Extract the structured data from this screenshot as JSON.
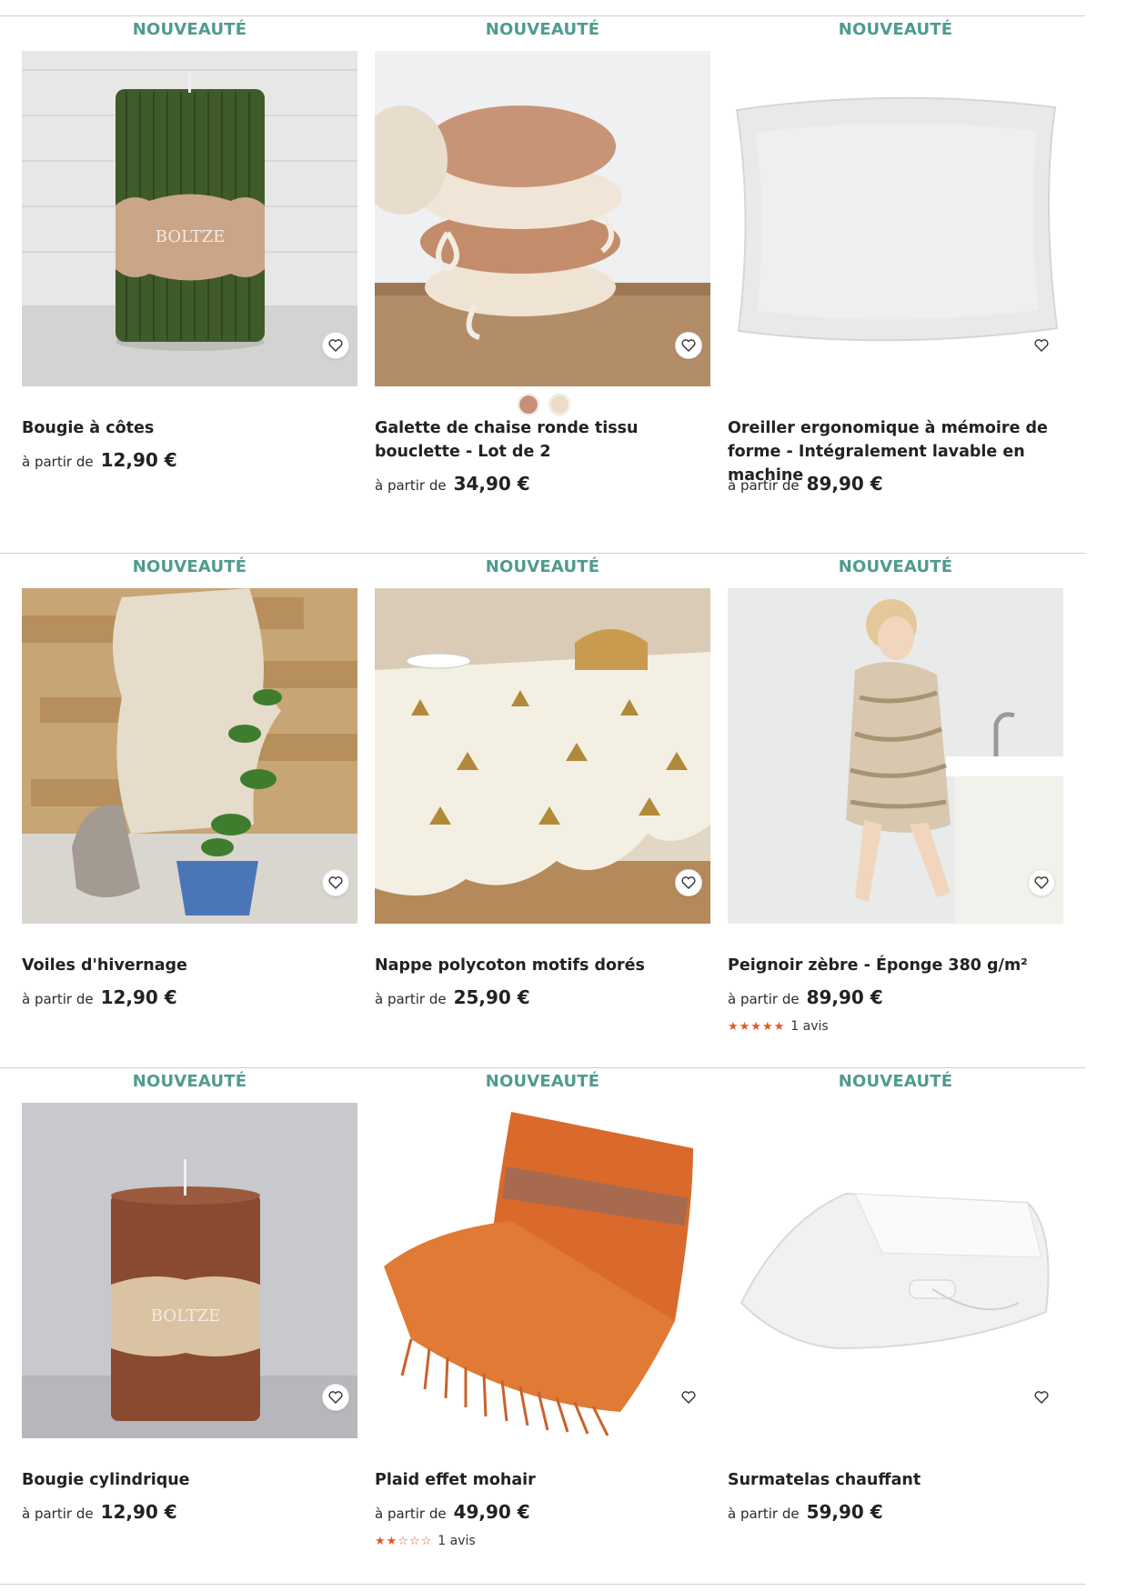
{
  "grid": {
    "rows": [
      {
        "cards": [
          {
            "badge": "NOUVEAUTÉ",
            "name": "Bougie à côtes",
            "from": "à partir de",
            "price": "12,90 €",
            "image": "green-ribbed-candle",
            "colors": []
          },
          {
            "badge": "NOUVEAUTÉ",
            "name": "Galette de chaise ronde tissu bouclette - Lot de 2",
            "from": "à partir de",
            "price": "34,90 €",
            "image": "boucle-chair-pads",
            "colors": [
              "#c98f78",
              "#ecdcc8"
            ]
          },
          {
            "badge": "NOUVEAUTÉ",
            "name": "Oreiller ergonomique à mémoire de forme - Intégralement lavable en machine",
            "from": "à partir de",
            "price": "89,90 €",
            "image": "memory-foam-pillow",
            "colors": []
          }
        ]
      },
      {
        "cards": [
          {
            "badge": "NOUVEAUTÉ",
            "name": "Voiles d'hivernage",
            "from": "à partir de",
            "price": "12,90 €",
            "image": "winter-plant-fleece",
            "colors": []
          },
          {
            "badge": "NOUVEAUTÉ",
            "name": "Nappe polycoton motifs dorés",
            "from": "à partir de",
            "price": "25,90 €",
            "image": "golden-pattern-tablecloth",
            "colors": []
          },
          {
            "badge": "NOUVEAUTÉ",
            "name": "Peignoir zèbre - Éponge 380 g/m²",
            "from": "à partir de",
            "price": "89,90 €",
            "image": "zebra-bathrobe",
            "colors": [],
            "rating": {
              "stars": 5,
              "max": 5,
              "text": "1 avis"
            }
          }
        ]
      },
      {
        "cards": [
          {
            "badge": "NOUVEAUTÉ",
            "name": "Bougie cylindrique",
            "from": "à partir de",
            "price": "12,90 €",
            "image": "brown-cylinder-candle",
            "colors": []
          },
          {
            "badge": "NOUVEAUTÉ",
            "name": "Plaid effet mohair",
            "from": "à partir de",
            "price": "49,90 €",
            "image": "mohair-throw",
            "colors": [],
            "rating": {
              "stars": 2,
              "max": 5,
              "text": "1 avis"
            }
          },
          {
            "badge": "NOUVEAUTÉ",
            "name": "Surmatelas chauffant",
            "from": "à partir de",
            "price": "59,90 €",
            "image": "heated-mattress-topper",
            "colors": []
          }
        ]
      }
    ]
  },
  "icons": {
    "favorite": "heart-icon",
    "rating": "star-icon"
  },
  "colors": {
    "badge": "#4f9b8f",
    "star": "#e05a26"
  }
}
